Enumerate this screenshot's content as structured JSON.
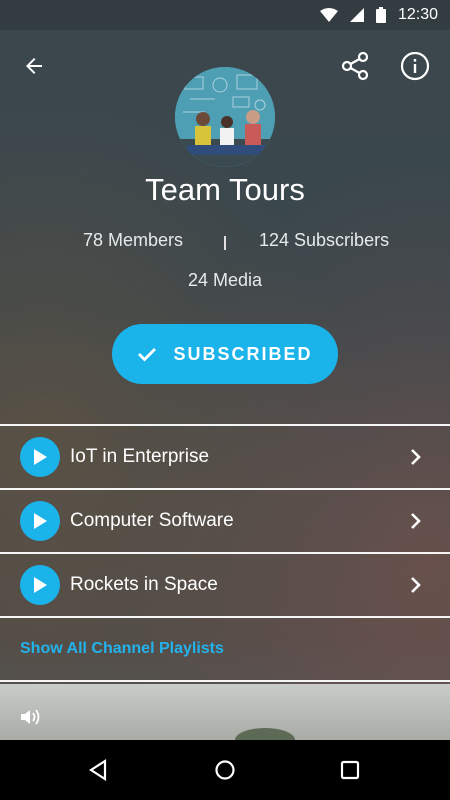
{
  "status_bar": {
    "time": "12:30"
  },
  "channel": {
    "name": "Team Tours",
    "members": "78 Members",
    "subscribers": "124 Subscribers",
    "media": "24 Media"
  },
  "subscribe_button": {
    "label": "SUBSCRIBED"
  },
  "playlists": [
    {
      "label": "IoT in Enterprise"
    },
    {
      "label": "Computer Software"
    },
    {
      "label": "Rockets in Space"
    }
  ],
  "show_all": {
    "label": "Show All Channel Playlists"
  },
  "colors": {
    "accent": "#1ab3ea",
    "link": "#22b3ec"
  }
}
